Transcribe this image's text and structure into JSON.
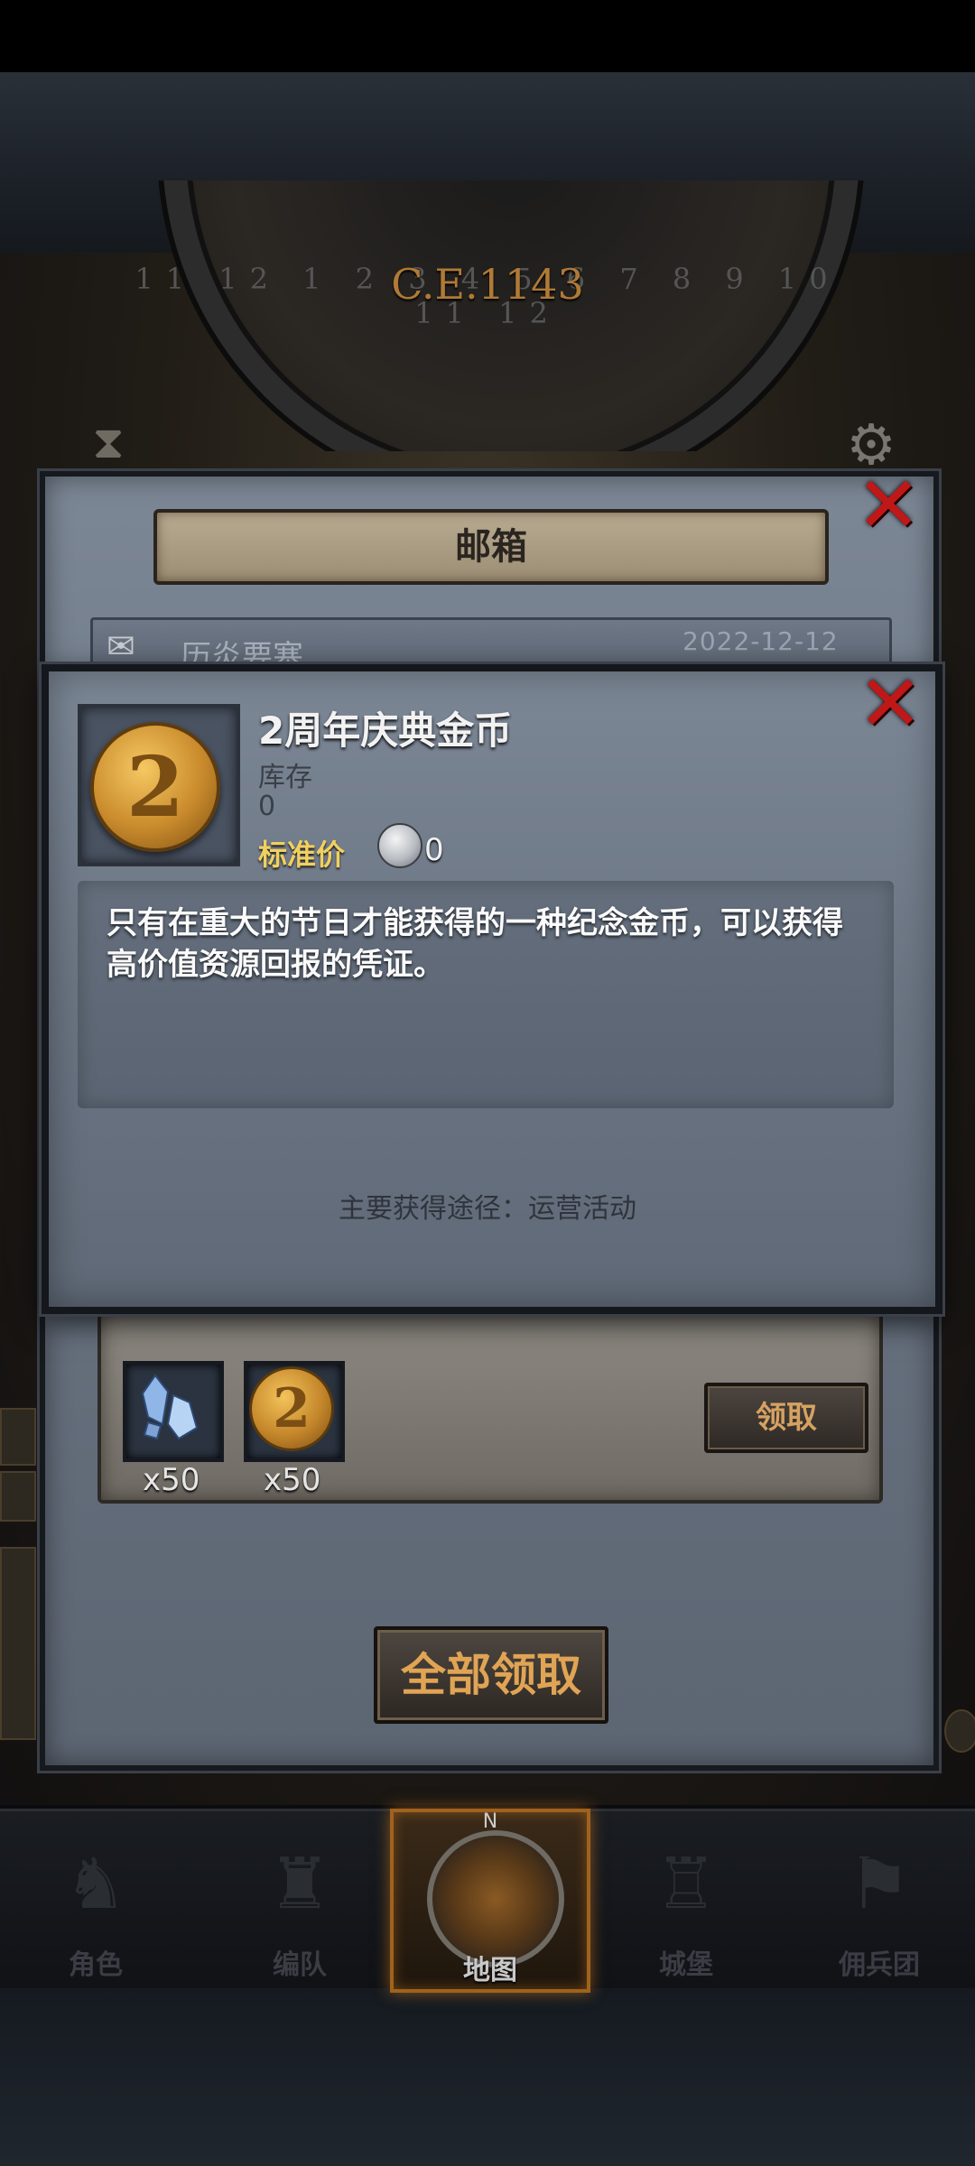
{
  "era": {
    "label": "C.E.1143",
    "dial_numbers": "11 12 1 2 3 4 5 6 7 8 9 10 11 12"
  },
  "mailbox": {
    "title": "邮箱",
    "mail_row": {
      "title": "历炎要塞",
      "date": "2022-12-12"
    },
    "rewards": [
      {
        "icon": "crystal-icon",
        "quantity": "x50"
      },
      {
        "icon": "coin-icon",
        "quantity": "x50"
      }
    ],
    "claim_label": "领取",
    "claim_all_label": "全部领取"
  },
  "item_popup": {
    "name": "2周年庆典金币",
    "coin_glyph": "2",
    "stock_label": "库存",
    "stock_value": "0",
    "std_price_label": "标准价",
    "std_price_value": "0",
    "description": "只有在重大的节日才能获得的一种纪念金币，可以获得高价值资源回报的凭证。",
    "source": "主要获得途径：运营活动"
  },
  "bottom_nav": [
    {
      "label": "角色",
      "icon": "knight-icon"
    },
    {
      "label": "编队",
      "icon": "formation-icon"
    },
    {
      "label": "地图",
      "icon": "compass-icon",
      "active": true,
      "north": "N"
    },
    {
      "label": "城堡",
      "icon": "castle-icon"
    },
    {
      "label": "佣兵团",
      "icon": "mercenary-icon"
    }
  ],
  "colors": {
    "close_red": "#c01818",
    "gold_text": "#e0a454",
    "price_label": "#f0d060",
    "active_nav_border": "#a0621c"
  }
}
